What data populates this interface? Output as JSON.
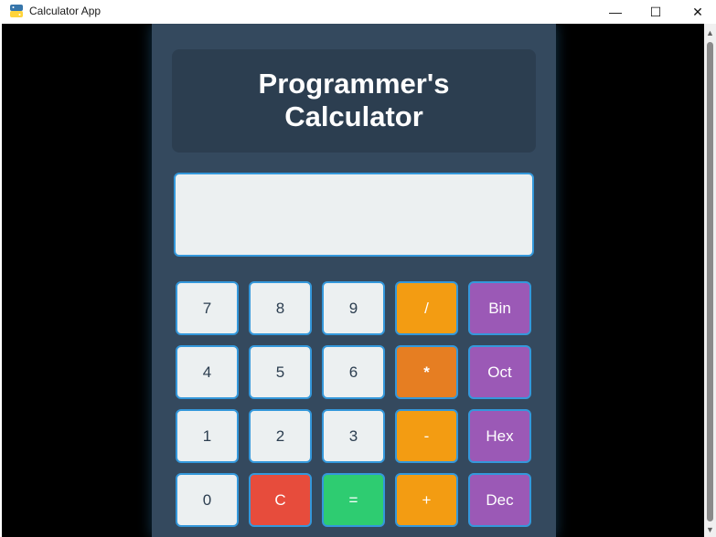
{
  "window": {
    "title": "Calculator App",
    "minimize_glyph": "—",
    "maximize_glyph": "☐",
    "close_glyph": "✕"
  },
  "calculator": {
    "heading": "Programmer's\nCalculator",
    "display_value": "",
    "buttons": [
      {
        "label": "7",
        "kind": "num"
      },
      {
        "label": "8",
        "kind": "num"
      },
      {
        "label": "9",
        "kind": "num"
      },
      {
        "label": "/",
        "kind": "op"
      },
      {
        "label": "Bin",
        "kind": "base"
      },
      {
        "label": "4",
        "kind": "num"
      },
      {
        "label": "5",
        "kind": "num"
      },
      {
        "label": "6",
        "kind": "num"
      },
      {
        "label": "*",
        "kind": "op-active"
      },
      {
        "label": "Oct",
        "kind": "base"
      },
      {
        "label": "1",
        "kind": "num"
      },
      {
        "label": "2",
        "kind": "num"
      },
      {
        "label": "3",
        "kind": "num"
      },
      {
        "label": "-",
        "kind": "op"
      },
      {
        "label": "Hex",
        "kind": "base"
      },
      {
        "label": "0",
        "kind": "num"
      },
      {
        "label": "C",
        "kind": "clear"
      },
      {
        "label": "=",
        "kind": "eq"
      },
      {
        "label": "+",
        "kind": "op"
      },
      {
        "label": "Dec",
        "kind": "base"
      }
    ]
  },
  "colors": {
    "panel": "#34495e",
    "header": "#2c3e50",
    "display": "#ecf0f1",
    "border_accent": "#3498db",
    "operator": "#f39c12",
    "operator_active": "#e67e22",
    "base": "#9b59b6",
    "clear": "#e74c3c",
    "equals": "#2ecc71"
  },
  "scrollbar": {
    "up_glyph": "▲",
    "down_glyph": "▼"
  }
}
